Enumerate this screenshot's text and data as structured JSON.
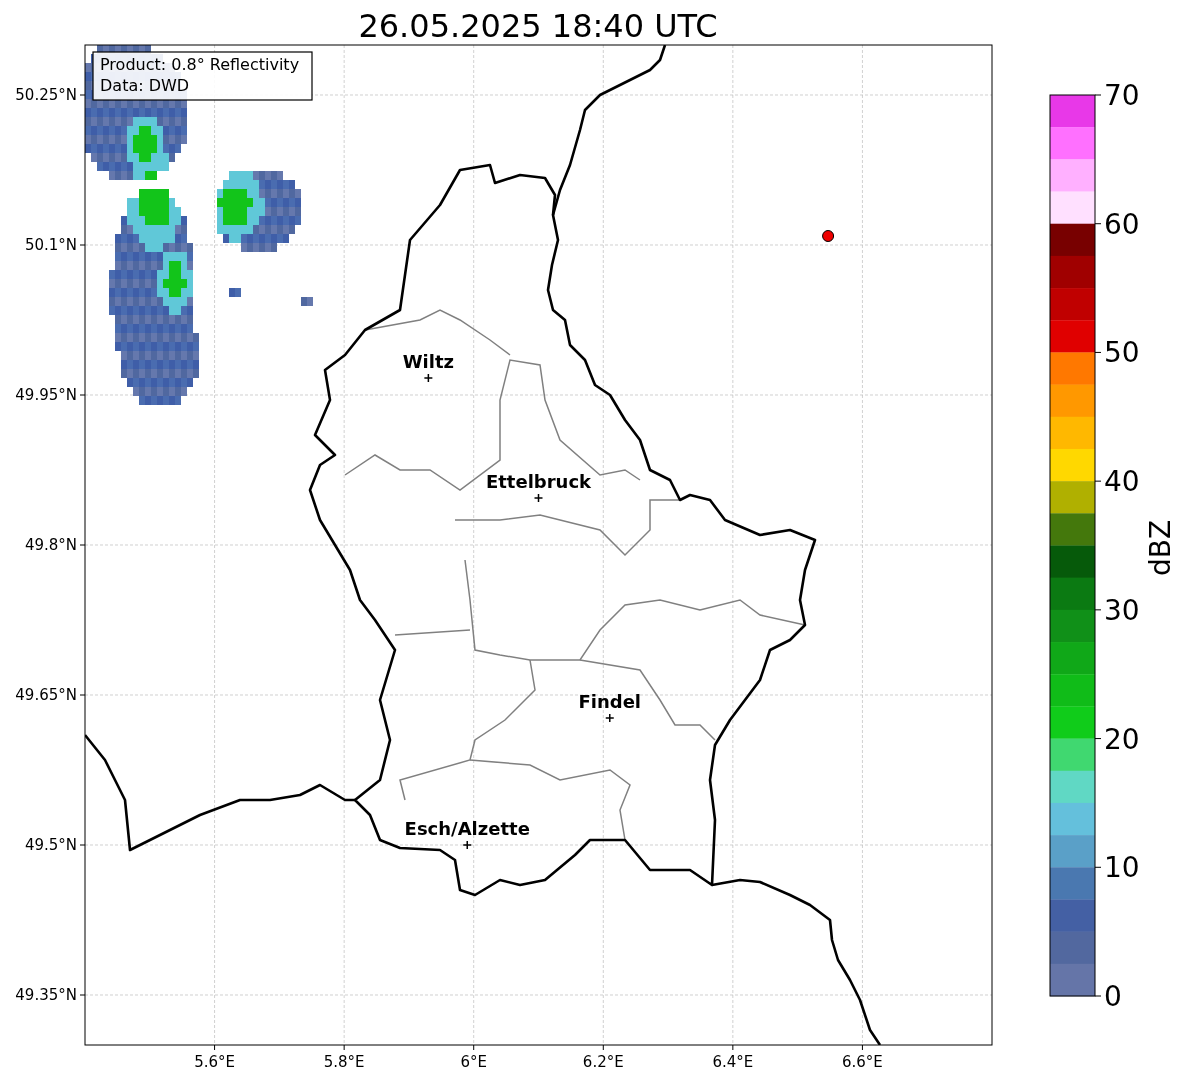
{
  "title": "26.05.2025 18:40 UTC",
  "info_box": [
    "Product: 0.8° Reflectivity",
    "Data: DWD"
  ],
  "map": {
    "yticks": [
      "50.25°N",
      "50.1°N",
      "49.95°N",
      "49.8°N",
      "49.65°N",
      "49.5°N",
      "49.35°N"
    ],
    "xticks": [
      "5.6°E",
      "5.8°E",
      "6°E",
      "6.2°E",
      "6.4°E",
      "6.6°E"
    ],
    "cities": [
      {
        "name": "Wiltz"
      },
      {
        "name": "Ettelbruck"
      },
      {
        "name": "Findel"
      },
      {
        "name": "Esch/Alzette"
      }
    ],
    "marker": {
      "color": "#ee0000"
    }
  },
  "colorbar": {
    "label": "dBZ",
    "ticks": [
      "70",
      "60",
      "50",
      "40",
      "30",
      "20",
      "10",
      "0"
    ],
    "bands": [
      {
        "color": "#e838e8"
      },
      {
        "color": "#ff70ff"
      },
      {
        "color": "#ffb0ff"
      },
      {
        "color": "#ffe0ff"
      },
      {
        "color": "#780000"
      },
      {
        "color": "#a00000"
      },
      {
        "color": "#c00000"
      },
      {
        "color": "#e00000"
      },
      {
        "color": "#ff7800"
      },
      {
        "color": "#ff9800"
      },
      {
        "color": "#ffb800"
      },
      {
        "color": "#ffd800"
      },
      {
        "color": "#b0b000"
      },
      {
        "color": "#44780c"
      },
      {
        "color": "#065a0a"
      },
      {
        "color": "#0b7a12"
      },
      {
        "color": "#109018"
      },
      {
        "color": "#10a818"
      },
      {
        "color": "#10bc18"
      },
      {
        "color": "#10cc1a"
      },
      {
        "color": "#40d870"
      },
      {
        "color": "#60d8c4"
      },
      {
        "color": "#64c0dc"
      },
      {
        "color": "#5aa0c8"
      },
      {
        "color": "#4a78b0"
      },
      {
        "color": "#4460a4"
      },
      {
        "color": "#52689f"
      },
      {
        "color": "#6575a8"
      }
    ]
  }
}
